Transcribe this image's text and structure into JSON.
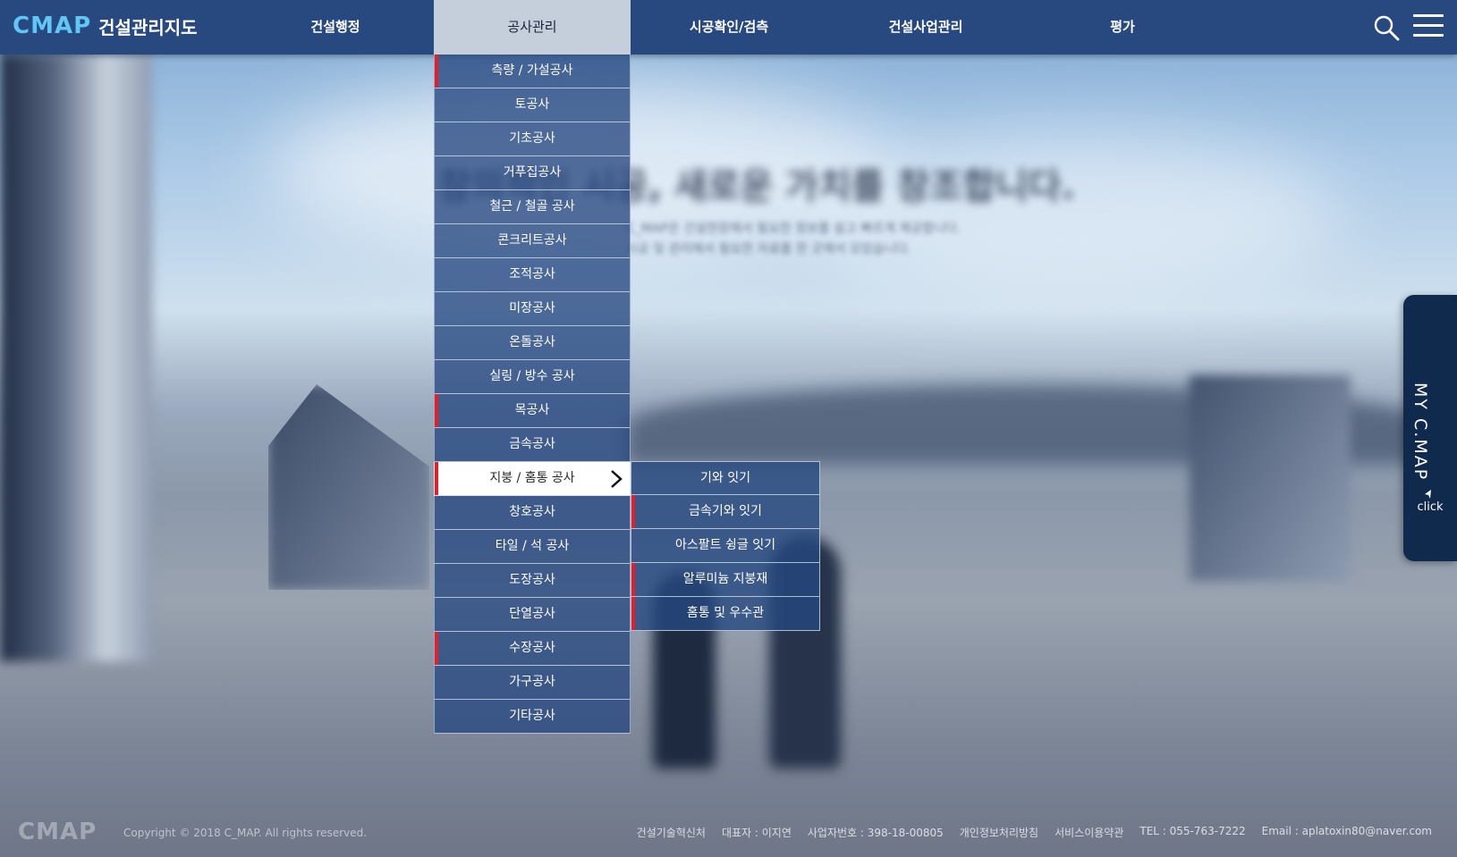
{
  "header": {
    "logo_mark": "CMAP",
    "logo_text": "건설관리지도",
    "nav": [
      "건설행정",
      "공사관리",
      "시공확인/검측",
      "건설사업관리",
      "평가"
    ],
    "active_nav": "공사관리"
  },
  "background": {
    "headline": "창의적인 시공, 새로운 가치를 창조합니다.",
    "subline_1": "C_MAP은 건설현장에서 필요한 정보를 쉽고 빠르게 제공합니다.",
    "subline_2": "시공 및 관리에서 필요한 자료를 한 곳에서 모았습니다."
  },
  "dropdown": {
    "items": [
      {
        "label": "측량 / 가설공사",
        "flag": true
      },
      {
        "label": "토공사",
        "flag": false
      },
      {
        "label": "기초공사",
        "flag": false
      },
      {
        "label": "거푸집공사",
        "flag": false
      },
      {
        "label": "철근 / 철골 공사",
        "flag": false
      },
      {
        "label": "콘크리트공사",
        "flag": false
      },
      {
        "label": "조적공사",
        "flag": false
      },
      {
        "label": "미장공사",
        "flag": false
      },
      {
        "label": "온돌공사",
        "flag": false
      },
      {
        "label": "실링 / 방수 공사",
        "flag": false
      },
      {
        "label": "목공사",
        "flag": true
      },
      {
        "label": "금속공사",
        "flag": false
      },
      {
        "label": "지붕 / 홈통 공사",
        "flag": true,
        "selected": true
      },
      {
        "label": "창호공사",
        "flag": false
      },
      {
        "label": "타일 / 석 공사",
        "flag": false
      },
      {
        "label": "도장공사",
        "flag": false
      },
      {
        "label": "단열공사",
        "flag": false
      },
      {
        "label": "수장공사",
        "flag": true
      },
      {
        "label": "가구공사",
        "flag": false
      },
      {
        "label": "기타공사",
        "flag": false
      }
    ]
  },
  "submenu": {
    "items": [
      {
        "label": "기와 잇기",
        "flag": false
      },
      {
        "label": "금속기와 잇기",
        "flag": true
      },
      {
        "label": "아스팔트 슁글 잇기",
        "flag": false
      },
      {
        "label": "알루미늄 지붕재",
        "flag": true
      },
      {
        "label": "홈통 및 우수관",
        "flag": true
      }
    ]
  },
  "side_tab": {
    "label": "MY C.MAP",
    "click": "click"
  },
  "footer": {
    "logo": "CMAP",
    "copyright": "Copyright © 2018 C_MAP. All rights reserved.",
    "company": "건설기술혁신처",
    "ceo": "대표자 : 이지연",
    "biz_no": "사업자번호 : 398-18-00805",
    "privacy": "개인정보처리방침",
    "terms": "서비스이용약관",
    "tel": "TEL : 055-763-7222",
    "email": "Email : aplatoxin80@naver.com"
  },
  "colors": {
    "header_bg": "#27497f",
    "accent_red": "#e0202a",
    "logo_cyan": "#5fc6f5",
    "side_tab_bg": "#0f2a4c"
  }
}
